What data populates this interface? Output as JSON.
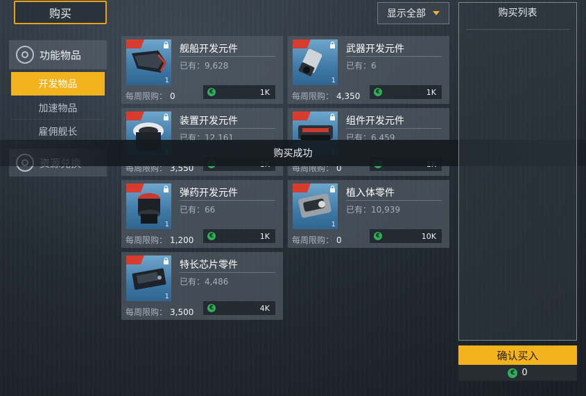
{
  "tab": {
    "buy_label": "购买"
  },
  "filter": {
    "label": "显示全部"
  },
  "nav": {
    "category1": "功能物品",
    "subitems": [
      "开发物品",
      "加速物品",
      "雇佣舰长"
    ],
    "category2": "资源兑换"
  },
  "items": [
    {
      "name": "舰船开发元件",
      "owned": "已有：9,628",
      "limit_label": "每周限购：",
      "limit": "0",
      "price": "1K",
      "qty": "1"
    },
    {
      "name": "武器开发元件",
      "owned": "已有：6",
      "limit_label": "每周限购：",
      "limit": "4,350",
      "price": "1K",
      "qty": "1"
    },
    {
      "name": "装置开发元件",
      "owned": "已有：12,161",
      "limit_label": "每周限购：",
      "limit": "3,550",
      "price": "1K",
      "qty": "1"
    },
    {
      "name": "组件开发元件",
      "owned": "已有：6,459",
      "limit_label": "每周限购：",
      "limit": "0",
      "price": "1K",
      "qty": "1"
    },
    {
      "name": "弹药开发元件",
      "owned": "已有：66",
      "limit_label": "每周限购：",
      "limit": "1,200",
      "price": "1K",
      "qty": "1"
    },
    {
      "name": "植入体零件",
      "owned": "已有：10,939",
      "limit_label": "每周限购：",
      "limit": "0",
      "price": "10K",
      "qty": "1"
    },
    {
      "name": "特长芯片零件",
      "owned": "已有：4,486",
      "limit_label": "每周限购：",
      "limit": "3,500",
      "price": "4K",
      "qty": "1"
    }
  ],
  "toast": "购买成功",
  "cart": {
    "title": "购买列表",
    "confirm_label": "确认买入",
    "total": "0"
  },
  "icons": {
    "currency": "credit-icon",
    "lock": "lock-icon",
    "category": "gear-icon",
    "filter": "caret-down-icon"
  },
  "colors": {
    "accent": "#f3b31c",
    "currency": "#2fae5c",
    "tag": "#d63d2e"
  }
}
